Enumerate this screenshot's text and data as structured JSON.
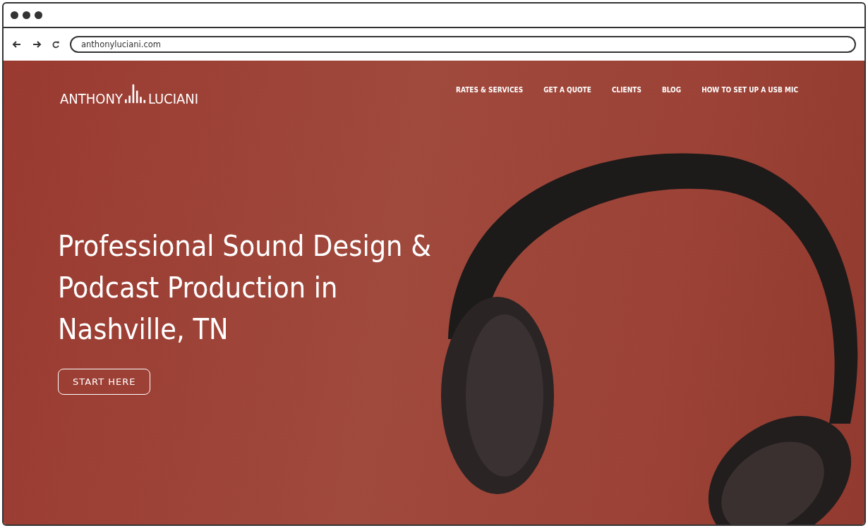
{
  "browser": {
    "url": "anthonyluciani.com"
  },
  "logo": {
    "first": "ANTHONY",
    "last": "LUCIANI"
  },
  "nav": [
    {
      "label": "RATES & SERVICES"
    },
    {
      "label": "GET A QUOTE"
    },
    {
      "label": "CLIENTS"
    },
    {
      "label": "BLOG"
    },
    {
      "label": "HOW TO SET UP A USB MIC"
    }
  ],
  "hero": {
    "heading": "Professional Sound Design & Podcast Production in Nashville, TN",
    "button": "START HERE"
  }
}
